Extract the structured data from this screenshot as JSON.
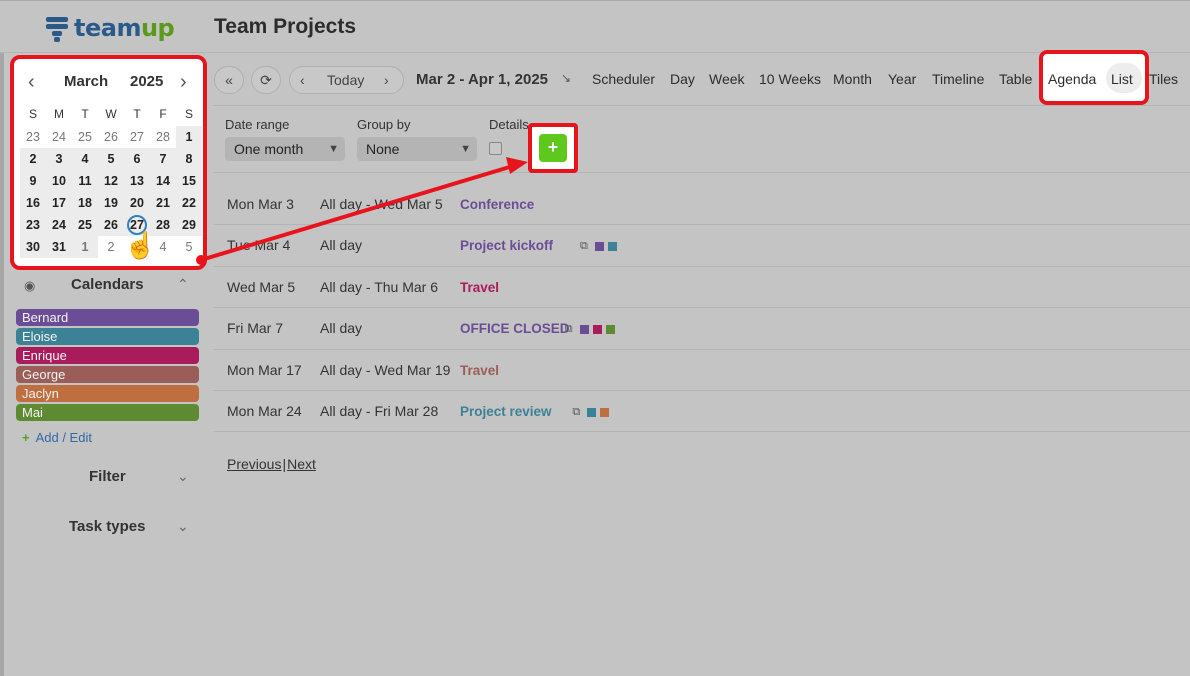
{
  "app": {
    "logo_text_a": "team",
    "logo_text_b": "up",
    "title": "Team Projects"
  },
  "minical": {
    "month": "March",
    "year": "2025",
    "dows": [
      "S",
      "M",
      "T",
      "W",
      "T",
      "F",
      "S"
    ],
    "weeks": [
      [
        {
          "d": "23",
          "t": "other"
        },
        {
          "d": "24",
          "t": "other"
        },
        {
          "d": "25",
          "t": "other"
        },
        {
          "d": "26",
          "t": "other"
        },
        {
          "d": "27",
          "t": "other"
        },
        {
          "d": "28",
          "t": "other"
        },
        {
          "d": "1",
          "t": "cur"
        }
      ],
      [
        {
          "d": "2",
          "t": "cur"
        },
        {
          "d": "3",
          "t": "cur"
        },
        {
          "d": "4",
          "t": "cur"
        },
        {
          "d": "5",
          "t": "cur"
        },
        {
          "d": "6",
          "t": "cur"
        },
        {
          "d": "7",
          "t": "cur"
        },
        {
          "d": "8",
          "t": "cur"
        }
      ],
      [
        {
          "d": "9",
          "t": "cur"
        },
        {
          "d": "10",
          "t": "cur"
        },
        {
          "d": "11",
          "t": "cur"
        },
        {
          "d": "12",
          "t": "cur"
        },
        {
          "d": "13",
          "t": "cur"
        },
        {
          "d": "14",
          "t": "cur"
        },
        {
          "d": "15",
          "t": "cur"
        }
      ],
      [
        {
          "d": "16",
          "t": "cur"
        },
        {
          "d": "17",
          "t": "cur"
        },
        {
          "d": "18",
          "t": "cur"
        },
        {
          "d": "19",
          "t": "cur"
        },
        {
          "d": "20",
          "t": "cur"
        },
        {
          "d": "21",
          "t": "cur"
        },
        {
          "d": "22",
          "t": "cur"
        }
      ],
      [
        {
          "d": "23",
          "t": "cur"
        },
        {
          "d": "24",
          "t": "cur"
        },
        {
          "d": "25",
          "t": "cur"
        },
        {
          "d": "26",
          "t": "cur"
        },
        {
          "d": "27",
          "t": "today"
        },
        {
          "d": "28",
          "t": "cur"
        },
        {
          "d": "29",
          "t": "cur"
        }
      ],
      [
        {
          "d": "30",
          "t": "cur"
        },
        {
          "d": "31",
          "t": "cur"
        },
        {
          "d": "1",
          "t": "other-cur"
        },
        {
          "d": "2",
          "t": "other"
        },
        {
          "d": "3",
          "t": "other"
        },
        {
          "d": "4",
          "t": "other"
        },
        {
          "d": "5",
          "t": "other"
        }
      ]
    ]
  },
  "calendars": {
    "title": "Calendars",
    "items": [
      {
        "name": "Bernard",
        "color": "#6a4d96"
      },
      {
        "name": "Eloise",
        "color": "#3b8297"
      },
      {
        "name": "Enrique",
        "color": "#a81c5c"
      },
      {
        "name": "George",
        "color": "#9a5d57"
      },
      {
        "name": "Jaclyn",
        "color": "#bf6f3f"
      },
      {
        "name": "Mai",
        "color": "#5e8a32"
      }
    ],
    "add_edit": "Add / Edit"
  },
  "sections": {
    "filter": "Filter",
    "task_types": "Task types"
  },
  "toolbar": {
    "today": "Today",
    "range": "Mar 2 - Apr 1, 2025",
    "views": [
      "Scheduler",
      "Day",
      "Week",
      "10 Weeks",
      "Month",
      "Year",
      "Timeline",
      "Table",
      "Agenda",
      "List",
      "Tiles"
    ]
  },
  "filters": {
    "date_range_label": "Date range",
    "date_range_value": "One month",
    "group_by_label": "Group by",
    "group_by_value": "None",
    "details_label": "Details"
  },
  "events": [
    {
      "date": "Mon Mar 3",
      "time": "All day - Wed Mar 5",
      "title": "Conference",
      "color": "#6a4d96",
      "copy": false,
      "swatches": []
    },
    {
      "date": "Tue Mar 4",
      "time": "All day",
      "title": "Project kickoff",
      "color": "#6a4d96",
      "copy": true,
      "swatches": [
        "#6a4d96",
        "#3b8297"
      ]
    },
    {
      "date": "Wed Mar 5",
      "time": "All day - Thu Mar 6",
      "title": "Travel",
      "color": "#a81c5c",
      "copy": false,
      "swatches": []
    },
    {
      "date": "Fri Mar 7",
      "time": "All day",
      "title": "OFFICE CLOSED",
      "color": "#6a4d96",
      "copy": true,
      "swatches": [
        "#6a4d96",
        "#a81c5c",
        "#5e8a32"
      ]
    },
    {
      "date": "Mon Mar 17",
      "time": "All day - Wed Mar 19",
      "title": "Travel",
      "color": "#9a5d57",
      "copy": false,
      "swatches": []
    },
    {
      "date": "Mon Mar 24",
      "time": "All day - Fri Mar 28",
      "title": "Project review",
      "color": "#3b8297",
      "copy": true,
      "swatches": [
        "#3b8297",
        "#bf6f3f"
      ]
    }
  ],
  "pager": {
    "prev": "Previous",
    "next": "Next"
  },
  "colors": {
    "highlight": "#e8141c",
    "add_button": "#5fc81c",
    "today_ring": "#2f7fc2"
  }
}
